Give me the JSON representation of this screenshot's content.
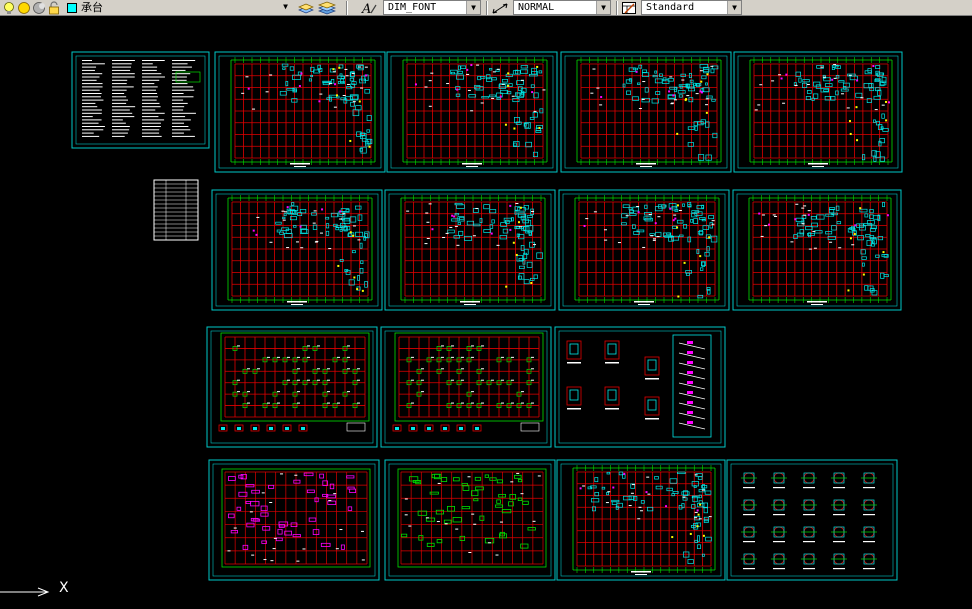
{
  "toolbar": {
    "layer_combo": {
      "value": "承台"
    },
    "text_style": {
      "value": "DIM_FONT"
    },
    "dim_style": {
      "value": "NORMAL"
    },
    "table_style": {
      "value": "Standard"
    },
    "icons": [
      "lightbulb-icon",
      "sun-icon",
      "freeze-icon",
      "lock-icon",
      "color-swatch-icon",
      "layer-properties-icon",
      "layers-icon",
      "text-style-icon",
      "dim-style-icon",
      "table-style-icon"
    ]
  },
  "colors": {
    "background": "#000000",
    "sheet_border": "#00c8c8",
    "column_grid": "#e00000",
    "axis_grid": "#00e000",
    "structure": "#00e8e8",
    "magenta_elements": "#ff00ff",
    "yellow_elements": "#ffff00",
    "toolbar_bg": "#d4d0c8"
  },
  "ucs": {
    "x_label": "X"
  }
}
